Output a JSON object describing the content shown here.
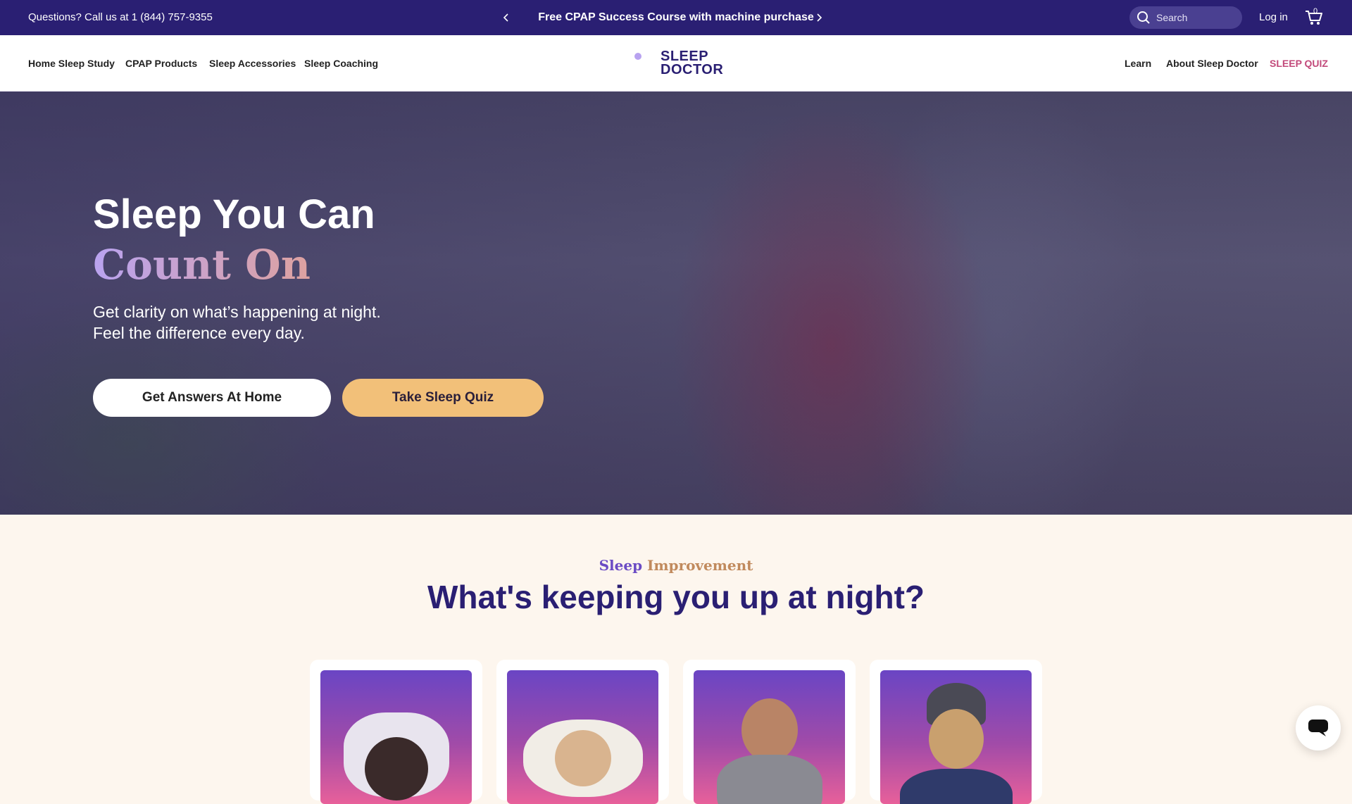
{
  "topbar": {
    "phone": "Questions? Call us at 1 (844) 757-9355",
    "promo": "Free CPAP Success Course with machine purchase",
    "search_placeholder": "Search",
    "login": "Log in",
    "cart_count": "0"
  },
  "nav": {
    "left": [
      "Home Sleep Study",
      "CPAP Products",
      "Sleep Accessories",
      "Sleep Coaching"
    ],
    "logo_line1": "SLEEP",
    "logo_line2": "DOCTOR",
    "right": [
      "Learn",
      "About Sleep Doctor",
      "SLEEP QUIZ"
    ]
  },
  "hero": {
    "title": "Sleep You Can",
    "accent": "Count On",
    "subtitle_line1": "Get clarity on what’s happening at night.",
    "subtitle_line2": "Feel the difference every day.",
    "primary_button": "Get Answers At Home",
    "secondary_button": "Take Sleep Quiz"
  },
  "section": {
    "eyebrow_part1": "Sleep",
    "eyebrow_part2": "Improvement",
    "title": "What's keeping you up at night?"
  },
  "colors": {
    "brand_navy": "#2a1f73",
    "accent_orange": "#f2c079",
    "quiz_pink": "#c2497a",
    "cream": "#fdf6ee"
  }
}
